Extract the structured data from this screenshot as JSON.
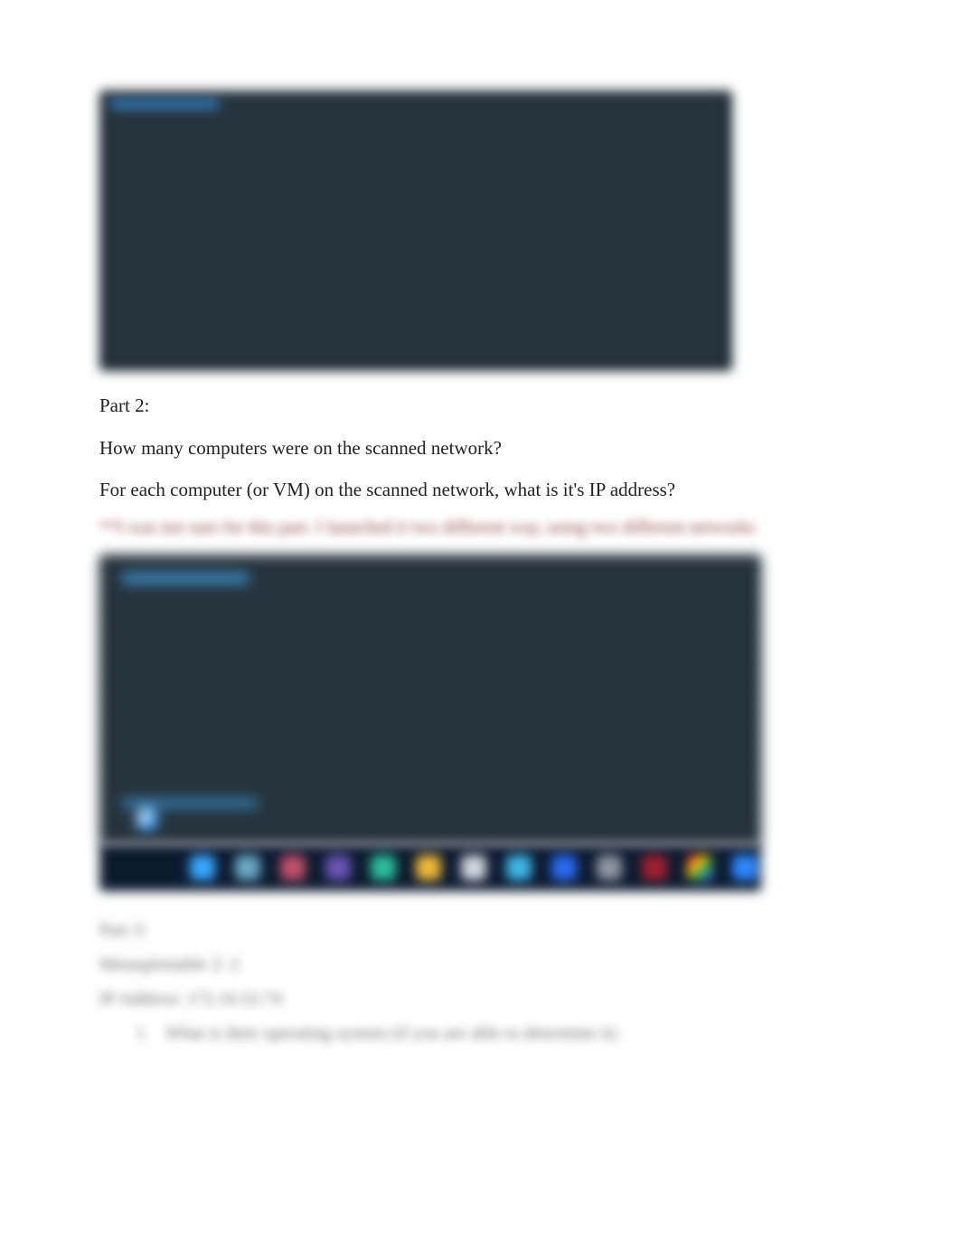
{
  "image1": {
    "alt": "terminal-output-screenshot"
  },
  "text": {
    "part2_heading": "Part 2:",
    "q1": "How many computers were on the scanned network?",
    "q2": "For each computer (or VM) on the scanned network, what is it's IP address?",
    "blurred_note": "**I was not sure for this part. I launched it two different way, using two different networks"
  },
  "image2": {
    "alt": "network-scan-screenshot-with-taskbar"
  },
  "blurred_followup": {
    "part3_heading": "Part 3:",
    "line_a": "Metasploitable 2: 2",
    "line_b": "IP Address: 172.16.52.74",
    "bullet_number": "1.",
    "bullet_text": "What is their operating system (if you are able to determine it)"
  },
  "taskbar_icons": [
    "globe-icon",
    "terminal-icon",
    "bug-icon",
    "app-icon",
    "wave-icon",
    "folder-icon",
    "disc-icon",
    "drop-icon",
    "shield-icon",
    "gear-icon",
    "record-icon",
    "chrome-icon",
    "edge-icon"
  ]
}
